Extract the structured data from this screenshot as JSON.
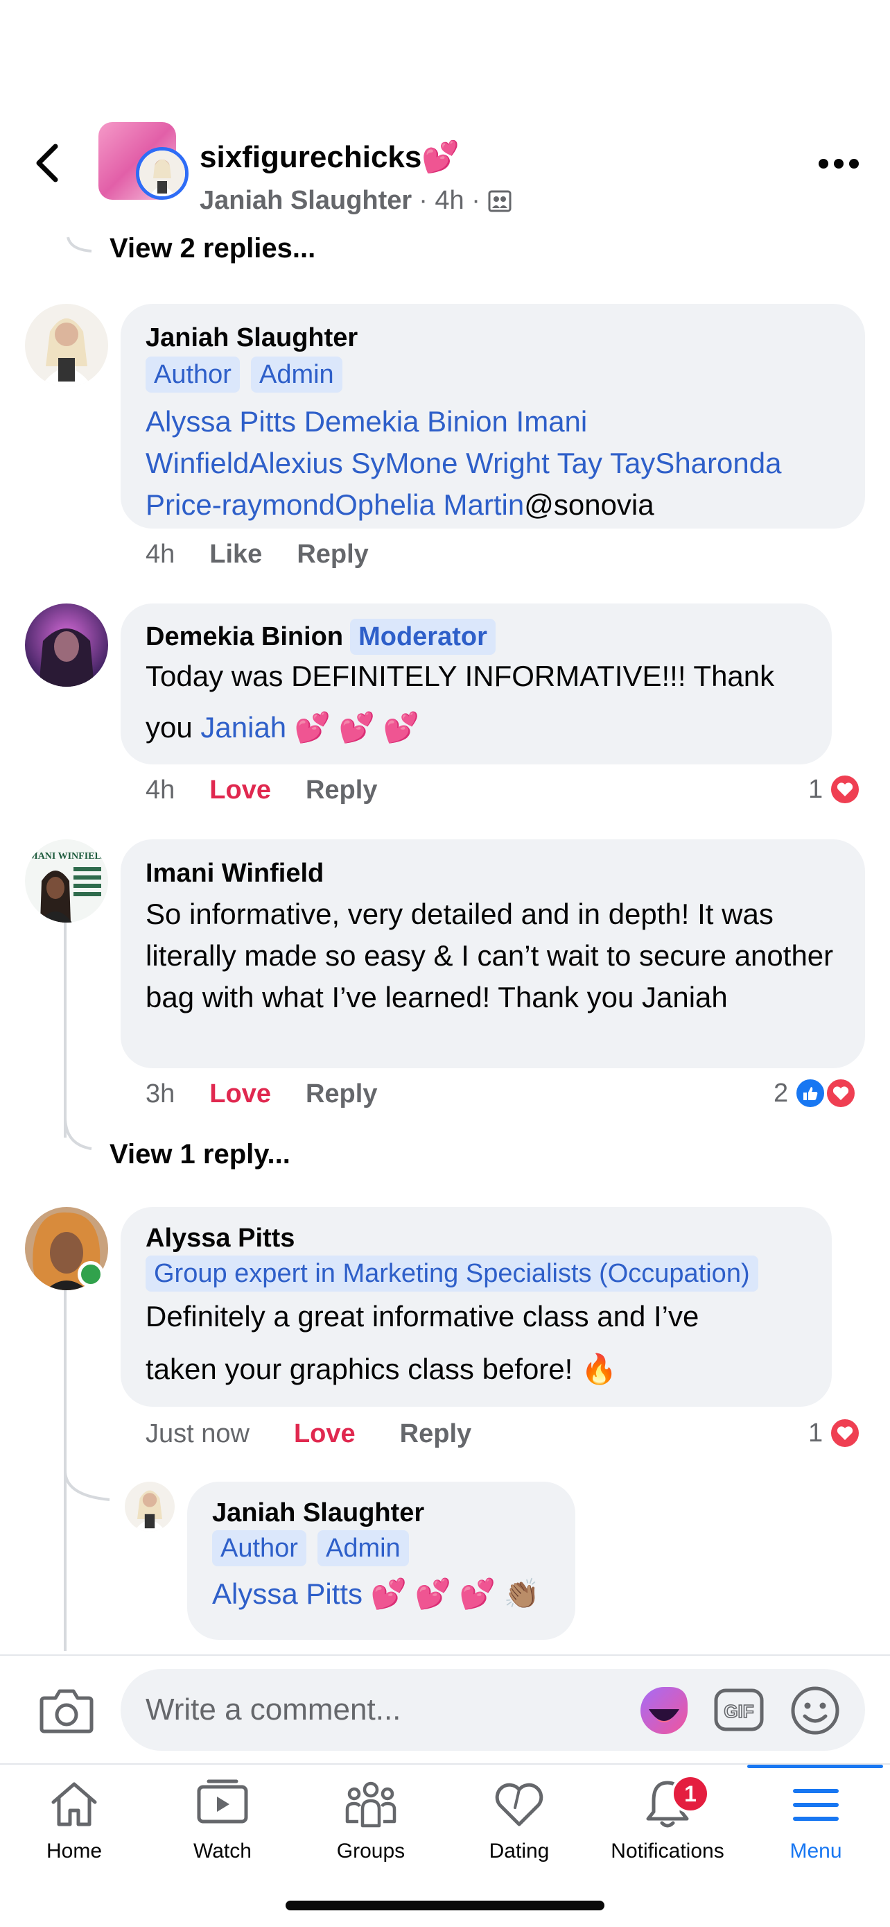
{
  "header": {
    "group_name": "sixfigurechicks💕",
    "author": "Janiah Slaughter",
    "time": "· 4h ·"
  },
  "thread": {
    "view_replies_top": "View 2 replies...",
    "view_replies_imani": "View 1 reply..."
  },
  "comments": [
    {
      "name": "Janiah Slaughter",
      "badges": [
        "Author",
        "Admin"
      ],
      "mentions_line1": "Alyssa Pitts Demekia Binion Imani",
      "mentions_line2": "WinfieldAlexius SyMone Wright Tay TaySharonda",
      "mentions_line3": "Price-raymondOphelia Martin",
      "plain_suffix": "@sonovia",
      "time": "4h",
      "action_react": "Like",
      "action_reply": "Reply"
    },
    {
      "name": "Demekia Binion",
      "badges": [
        "Moderator"
      ],
      "text_line1": "Today was DEFINITELY INFORMATIVE!!! Thank",
      "text_line2_prefix": "you",
      "mention": "Janiah",
      "emoji": "💕 💕 💕",
      "time": "4h",
      "action_react": "Love",
      "action_reply": "Reply",
      "reaction_count": "1"
    },
    {
      "name": "Imani Winfield",
      "text": "So informative, very detailed and in depth! It was literally made so easy & I can’t wait to secure another bag with what I’ve learned! Thank you Janiah",
      "time": "3h",
      "action_react": "Love",
      "action_reply": "Reply",
      "reaction_count": "2"
    },
    {
      "name": "Alyssa Pitts",
      "badges": [
        "Group expert in Marketing Specialists (Occupation)"
      ],
      "text_line1": "Definitely a great informative class and I’ve",
      "text_line2": "taken your graphics class before! 🔥",
      "time": "Just now",
      "action_react": "Love",
      "action_reply": "Reply",
      "reaction_count": "1"
    },
    {
      "name": "Janiah Slaughter",
      "badges": [
        "Author",
        "Admin"
      ],
      "mention": "Alyssa Pitts",
      "emoji": "💕 💕 💕 👏🏽"
    }
  ],
  "composer": {
    "placeholder": "Write a comment...",
    "gif_label": "GIF"
  },
  "tabs": [
    {
      "label": "Home",
      "icon": "home-icon"
    },
    {
      "label": "Watch",
      "icon": "watch-icon"
    },
    {
      "label": "Groups",
      "icon": "groups-icon"
    },
    {
      "label": "Dating",
      "icon": "dating-icon"
    },
    {
      "label": "Notifications",
      "icon": "bell-icon",
      "badge": "1"
    },
    {
      "label": "Menu",
      "icon": "menu-icon",
      "active": true
    }
  ],
  "colors": {
    "accent": "#1877f2",
    "mention": "#2e5fc9",
    "love": "#e0284f",
    "bubble": "#f0f2f5"
  }
}
